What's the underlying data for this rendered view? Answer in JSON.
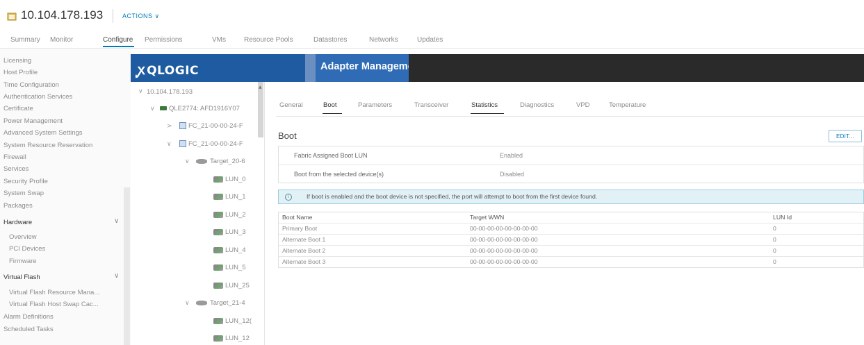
{
  "header": {
    "title": "10.104.178.193",
    "actions_label": "ACTIONS ∨"
  },
  "tabs": [
    "Summary",
    "Monitor",
    "Configure",
    "Permissions",
    "VMs",
    "Resource Pools",
    "Datastores",
    "Networks",
    "Updates"
  ],
  "active_tab": "Configure",
  "sidebar": {
    "items_top": [
      "Licensing",
      "Host Profile",
      "Time Configuration",
      "Authentication Services",
      "Certificate",
      "Power Management",
      "Advanced System Settings",
      "System Resource Reservation",
      "Firewall",
      "Services",
      "Security Profile",
      "System Swap",
      "Packages"
    ],
    "hardware": {
      "heading": "Hardware",
      "items": [
        "Overview",
        "PCI Devices",
        "Firmware"
      ]
    },
    "virtual_flash": {
      "heading": "Virtual Flash",
      "items": [
        "Virtual Flash Resource Mana...",
        "Virtual Flash Host Swap Cac..."
      ]
    },
    "items_bottom": [
      "Alarm Definitions",
      "Scheduled Tasks"
    ]
  },
  "banner": {
    "logo": "QLOGIC",
    "title": "Adapter Management"
  },
  "tree": {
    "host": "10.104.178.193",
    "adapter": "QLE2774: AFD1916Y07",
    "port1": "FC_21-00-00-24-F",
    "port2": "FC_21-00-00-24-F",
    "target1": "Target_20-6",
    "luns1": [
      "LUN_0",
      "LUN_1",
      "LUN_2",
      "LUN_3",
      "LUN_4",
      "LUN_5",
      "LUN_25"
    ],
    "target2": "Target_21-4",
    "luns2": [
      "LUN_12(",
      "LUN_12"
    ]
  },
  "content_tabs": [
    "General",
    "Boot",
    "Parameters",
    "Transceiver",
    "Statistics",
    "Diagnostics",
    "VPD",
    "Temperature"
  ],
  "boot": {
    "title": "Boot",
    "edit_label": "EDIT...",
    "settings": [
      {
        "label": "Fabric Assigned Boot LUN",
        "value": "Enabled"
      },
      {
        "label": "Boot from the selected device(s)",
        "value": "Disabled"
      }
    ],
    "info_icon": "info-icon",
    "info": "If boot is enabled and the boot device is not specified, the port will attempt to boot from the first device found.",
    "table": {
      "headers": [
        "Boot Name",
        "Target WWN",
        "LUN Id"
      ],
      "rows": [
        [
          "Primary Boot",
          "00-00-00-00-00-00-00-00",
          "0"
        ],
        [
          "Alternate Boot 1",
          "00-00-00-00-00-00-00-00",
          "0"
        ],
        [
          "Alternate Boot 2",
          "00-00-00-00-00-00-00-00",
          "0"
        ],
        [
          "Alternate Boot 3",
          "00-00-00-00-00-00-00-00",
          "0"
        ]
      ]
    }
  }
}
